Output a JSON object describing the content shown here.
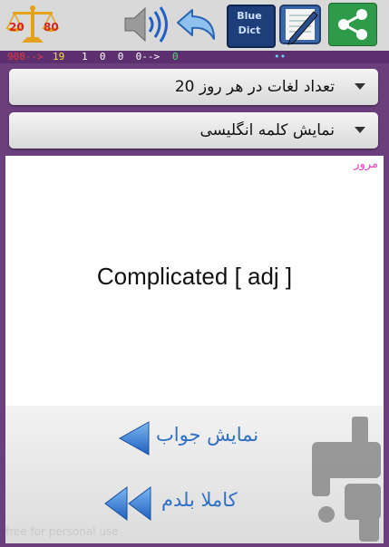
{
  "toolbar": {
    "icons": [
      "share-icon",
      "edit-note-icon",
      "blue-dict-icon",
      "back-arrow-icon",
      "speaker-icon",
      "balance-scale-icon"
    ],
    "scale_left": "20",
    "scale_right": "80",
    "dict_line1": "Blue",
    "dict_line2": "Dict"
  },
  "status_bar": {
    "red_part": "908-->",
    "yellow_part": "19",
    "white_part": "1  0  0  0-->",
    "green_part": "0",
    "dots": "••"
  },
  "dropdowns": {
    "words_per_day": "تعداد لغات در هر روز 20",
    "show_mode": "نمایش کلمه انگلیسی"
  },
  "card": {
    "review_label": "مرور",
    "word": "Complicated [ adj ]"
  },
  "actions": {
    "show_answer": "نمایش جواب",
    "know_completely": "کاملا بلدم"
  },
  "watermark": "free for personal use",
  "colors": {
    "background": "#6a3f7c",
    "accent_blue": "#2f6fc6",
    "review_pink": "#e93bc7",
    "share_green": "#2e9b4a"
  }
}
